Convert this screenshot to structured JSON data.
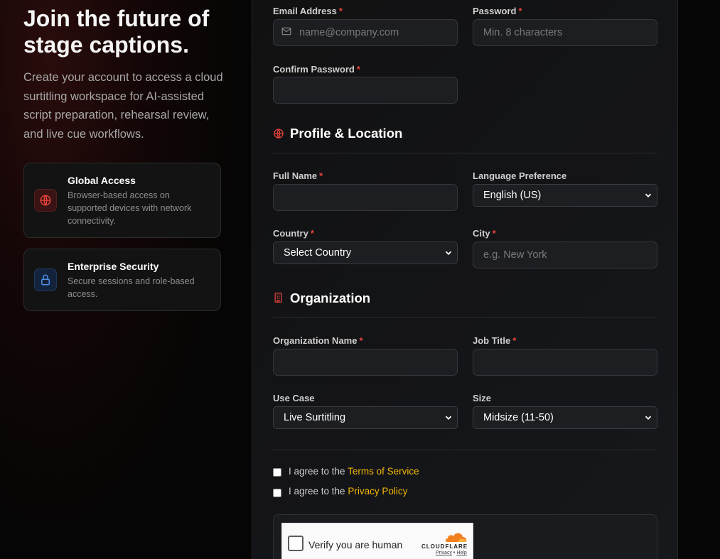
{
  "hero": {
    "title": "Join the future of stage captions.",
    "description": "Create your account to access a cloud surtitling workspace for AI-assisted script preparation, rehearsal review, and live cue workflows."
  },
  "features": [
    {
      "title": "Global Access",
      "text": "Browser-based access on supported devices with network connectivity.",
      "icon": "globe-icon",
      "accent": "#e8433a"
    },
    {
      "title": "Enterprise Security",
      "text": "Secure sessions and role-based access.",
      "icon": "lock-icon",
      "accent": "#4f8fe8"
    }
  ],
  "account": {
    "email_label": "Email Address",
    "email_placeholder": "name@company.com",
    "password_label": "Password",
    "password_placeholder": "Min. 8 characters",
    "confirm_label": "Confirm Password",
    "required_mark": "*"
  },
  "profile": {
    "section_title": "Profile & Location",
    "full_name_label": "Full Name",
    "language_label": "Language Preference",
    "language_value": "English (US)",
    "country_label": "Country",
    "country_value": "Select Country",
    "city_label": "City",
    "city_placeholder": "e.g. New York"
  },
  "organization": {
    "section_title": "Organization",
    "org_name_label": "Organization Name",
    "job_title_label": "Job Title",
    "use_case_label": "Use Case",
    "use_case_value": "Live Surtitling",
    "size_label": "Size",
    "size_value": "Midsize (11-50)"
  },
  "agreements": {
    "terms_prefix": "I agree to the",
    "terms_link": "Terms of Service",
    "privacy_prefix": "I agree to the",
    "privacy_link": "Privacy Policy"
  },
  "captcha": {
    "label": "Verify you are human",
    "brand": "CLOUDFLARE",
    "privacy": "Privacy",
    "separator": "•",
    "help": "Help"
  },
  "colors": {
    "accent_required": "#e8433a",
    "link": "#f2b705",
    "section_icon": "#e8433a"
  }
}
